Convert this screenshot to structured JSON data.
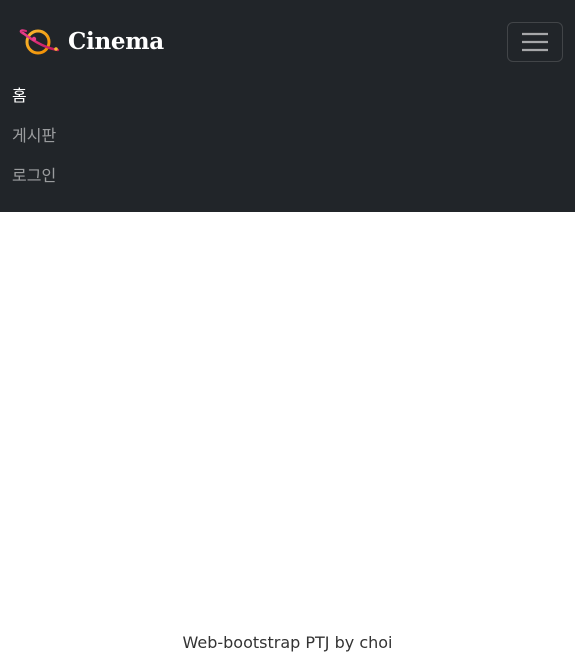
{
  "navbar": {
    "brand": {
      "text": "Cinema",
      "logo_icon": "planet-icon"
    },
    "toggler_icon": "hamburger-menu-icon",
    "links": [
      {
        "label": "홈",
        "active": true
      },
      {
        "label": "게시판",
        "active": false
      },
      {
        "label": "로그인",
        "active": false
      }
    ]
  },
  "footer": {
    "text": "Web-bootstrap PTJ by choi"
  },
  "colors": {
    "navbar_bg": "#212529",
    "link_active": "#ffffff",
    "link_inactive": "#a6a8aa",
    "logo_planet": "#f5a623",
    "logo_ring": "#d6336c"
  }
}
